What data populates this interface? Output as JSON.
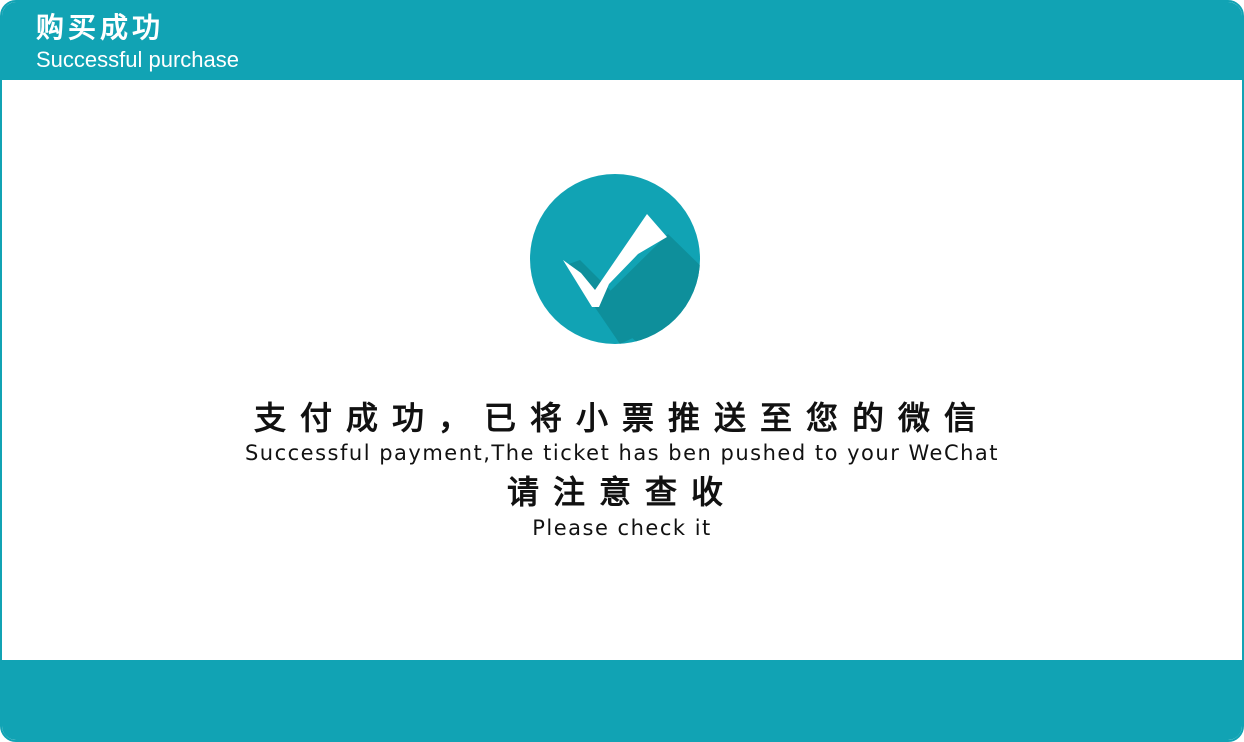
{
  "header": {
    "title_cn": "购买成功",
    "title_en": "Successful purchase"
  },
  "status": {
    "icon": "checkmark-icon",
    "message_cn": "支付成功，已将小票推送至您的微信",
    "message_en": "Successful payment,The ticket has ben pushed to your WeChat",
    "notice_cn": "请注意查收",
    "notice_en": "Please check it"
  },
  "colors": {
    "accent": "#11a3b4",
    "accent_shadow": "#0e8f9b",
    "text": "#111111",
    "background": "#ffffff"
  }
}
